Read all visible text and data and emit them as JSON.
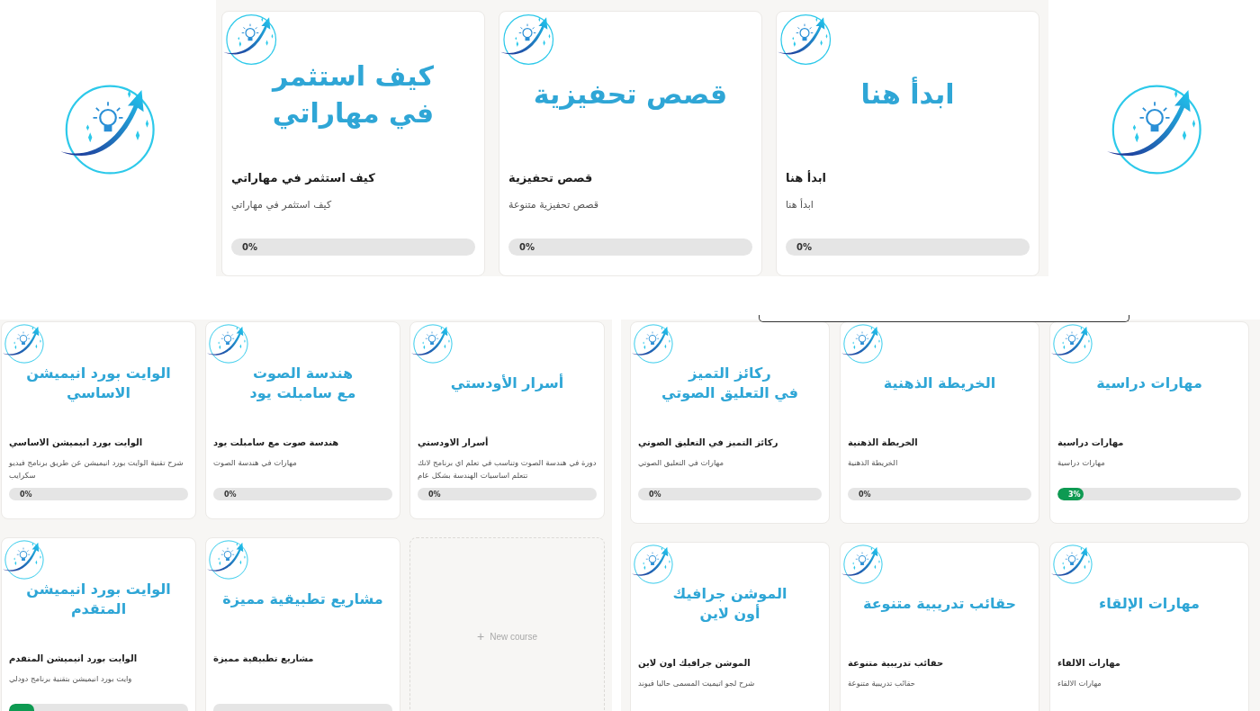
{
  "top": {
    "cards": [
      {
        "banner_lines": [
          "ابدأ هنا"
        ],
        "title": "ابدأ هنا",
        "description": "ابدأ هنا",
        "progress": {
          "label": "0%"
        }
      },
      {
        "banner_lines": [
          "قصص تحفيزية"
        ],
        "title": "قصص تحفيزية",
        "description": "قصص تحفيزية متنوعة",
        "progress": {
          "label": "0%"
        }
      },
      {
        "banner_lines": [
          "كيف استثمر",
          "في مهاراتي"
        ],
        "title": "كيف استثمر في مهاراتي",
        "description": "كيف استثمر في مهاراتي",
        "progress": {
          "label": "0%"
        }
      }
    ]
  },
  "bottom_left": {
    "items": [
      {
        "kind": "course",
        "banner_lines": [
          "أسرار الأودستي"
        ],
        "title": "أسرار الاودستي",
        "description": "دورة في هندسة الصوت وتناسب في تعلم اي برنامج لانك تتعلم اساسيات الهندسة بشكل عام",
        "progress": {
          "label": "0%"
        }
      },
      {
        "kind": "course",
        "banner_lines": [
          "هندسة الصوت",
          "مع سامبلت يود"
        ],
        "title": "هندسة صوت مع سامبلت يود",
        "description": "مهارات في هندسة الصوت",
        "progress": {
          "label": "0%"
        }
      },
      {
        "kind": "course",
        "banner_lines": [
          "الوايت بورد انيميشن",
          "الاساسي"
        ],
        "title": "الوايت بورد انيميشن الاساسي",
        "description": "شرح تقنية الوايت بورد انيميشن عن طريق برنامج فيديو سكرايب",
        "progress": {
          "label": "0%"
        }
      },
      {
        "kind": "new_course",
        "icon": "+",
        "label": "New course"
      },
      {
        "kind": "course",
        "banner_lines": [
          "مشاريع تطبيقية مميزة"
        ],
        "title": "مشاريع تطبيقية مميزة",
        "progress_bar": true
      },
      {
        "kind": "course",
        "banner_lines": [
          "الوايت بورد انيميشن",
          "المتقدم"
        ],
        "title": "الوايت بورد انيميشن المتقدم",
        "description": "وايت بورد انيميشن بتقنية برنامج دودلي",
        "progress": {
          "level": 0.14
        }
      }
    ]
  },
  "bottom_right": {
    "cards": [
      {
        "banner_lines": [
          "مهارات دراسية"
        ],
        "title": "مهارات دراسية",
        "description": "مهارات دراسية",
        "progress": {
          "level": 0.14,
          "label": "3%"
        }
      },
      {
        "banner_lines": [
          "الخريطة الذهنية"
        ],
        "title": "الخريطة الذهنية",
        "description": "الخريطة الذهنية",
        "progress": {
          "label": "0%"
        }
      },
      {
        "banner_lines": [
          "ركائز التميز",
          "في التعليق الصوتي"
        ],
        "title": "ركائز التميز في التعليق الصوتي",
        "description": "مهارات في التعليق الصوتي",
        "progress": {
          "label": "0%"
        }
      },
      {
        "banner_lines": [
          "مهارات الإلقاء"
        ],
        "title": "مهارات الالقاء",
        "description": "مهارات الالقاء"
      },
      {
        "banner_lines": [
          "حقائب تدريبية متنوعة"
        ],
        "title": "حقائب تدريبية متنوعة",
        "description": "حقائب تدريبية متنوعة"
      },
      {
        "banner_lines": [
          "الموشن جرافيك",
          "أون لاين"
        ],
        "title": "الموشن جرافيك اون لاين",
        "description": "شرح لجو اتيميت المسمى حاليا فيوند"
      }
    ]
  }
}
